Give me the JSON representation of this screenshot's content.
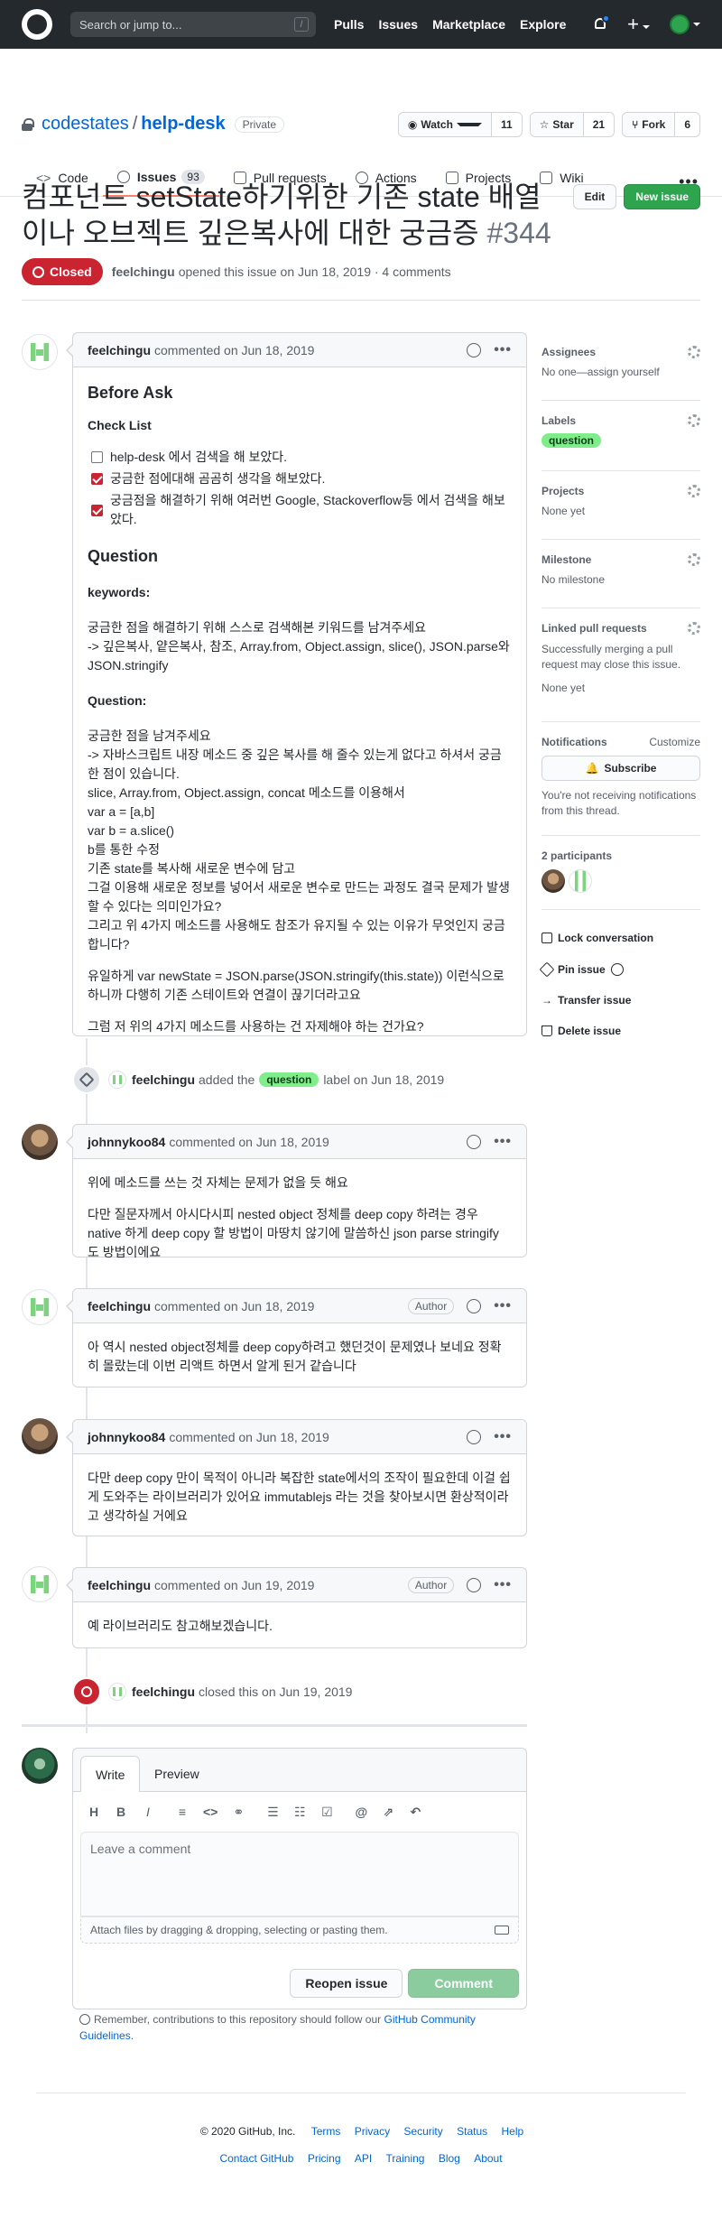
{
  "header": {
    "search_placeholder": "Search or jump to...",
    "search_key": "/",
    "nav": [
      "Pulls",
      "Issues",
      "Marketplace",
      "Explore"
    ]
  },
  "repo": {
    "owner": "codestates",
    "separator": "/",
    "name": "help-desk",
    "visibility": "Private",
    "watch_label": "Watch",
    "watch_count": "11",
    "star_label": "Star",
    "star_count": "21",
    "fork_label": "Fork",
    "fork_count": "6",
    "tabs": [
      {
        "label": "Code",
        "count": ""
      },
      {
        "label": "Issues",
        "count": "93"
      },
      {
        "label": "Pull requests",
        "count": ""
      },
      {
        "label": "Actions",
        "count": ""
      },
      {
        "label": "Projects",
        "count": ""
      },
      {
        "label": "Wiki",
        "count": ""
      }
    ],
    "more": "•••"
  },
  "issue": {
    "title": "컴포넌트 setState하기위한 기존 state 배열이나 오브젝트 깊은복사에 대한 궁금증",
    "number": "#344",
    "edit_label": "Edit",
    "new_issue_label": "New issue",
    "state": "Closed",
    "author": "feelchingu",
    "meta": "opened this issue on Jun 18, 2019 · 4 comments"
  },
  "comments": [
    {
      "author": "feelchingu",
      "date": "commented on Jun 18, 2019",
      "badge": "",
      "before_ask": "Before Ask",
      "checklist_title": "Check List",
      "tasks": [
        {
          "text": "help-desk 에서 검색을 해 보았다.",
          "checked": false
        },
        {
          "text": "궁금한 점에대해 곰곰히 생각을 해보았다.",
          "checked": true
        },
        {
          "text": "궁금점을 해결하기 위해 여러번 Google, Stackoverflow등 에서 검색을 해보았다.",
          "checked": true
        }
      ],
      "question_heading": "Question",
      "keywords_title": "keywords:",
      "keywords_text": "궁금한 점을 해결하기 위해 스스로 검색해본 키워드를 남겨주세요",
      "keywords_list": "-> 깊은복사, 얕은복사, 참조, Array.from, Object.assign, slice(), JSON.parse와 JSON.stringify",
      "question_title": "Question:",
      "question_lines": [
        "궁금한 점을 남겨주세요",
        "-> 자바스크립트 내장 메소드 중 깊은 복사를 해 줄수 있는게 없다고 하셔서 궁금한 점이 있습니다.",
        "slice, Array.from, Object.assign, concat 메소드를 이용해서",
        "var a = [a,b]",
        "var b = a.slice()",
        "b를 통한 수정",
        "기존 state를 복사해 새로운 변수에 담고",
        "그걸 이용해 새로운 정보를 넣어서 새로운 변수로 만드는 과정도 결국 문제가 발생할 수 있다는 의미인가요?",
        "그리고 위 4가지 메소드를 사용해도 참조가 유지될 수 있는 이유가 무엇인지 궁금합니다?"
      ],
      "para2": "유일하게 var newState = JSON.parse(JSON.stringify(this.state)) 이런식으로 하니까 다행히 기존 스테이트와 연결이 끊기더라고요",
      "para3": "그럼 저 위의 4가지 메소드를 사용하는 건 자제해야 하는 건가요?"
    },
    {
      "author": "johnnykoo84",
      "date": "commented on Jun 18, 2019",
      "badge": "",
      "p1": "위에 메소드를 쓰는 것 자체는 문제가 없을 듯 해요",
      "p2": "다만 질문자께서 아시다시피 nested object 정체를 deep copy 하려는 경우 native 하게 deep copy 할 방법이 마땅치 않기에 말씀하신 json parse stringify 도 방법이에요"
    },
    {
      "author": "feelchingu",
      "date": "commented on Jun 18, 2019",
      "badge": "Author",
      "p1": "아 역시 nested object정체를 deep copy하려고 했던것이 문제였나 보네요 정확히 몰랐는데 이번 리액트 하면서 알게 된거 같습니다"
    },
    {
      "author": "johnnykoo84",
      "date": "commented on Jun 18, 2019",
      "badge": "",
      "p1": "다만 deep copy 만이 목적이 아니라 복잡한 state에서의 조작이 필요한데 이걸 쉽게 도와주는 라이브러리가 있어요 immutablejs 라는 것을 찾아보시면 환상적이라고 생각하실 거에요"
    },
    {
      "author": "feelchingu",
      "date": "commented on Jun 19, 2019",
      "badge": "Author",
      "p1": "예 라이브러리도 참고해보겠습니다."
    }
  ],
  "events": {
    "label_event": {
      "actor": "feelchingu",
      "pre": "added the",
      "label": "question",
      "post": "label on Jun 18, 2019"
    },
    "close_event": {
      "actor": "feelchingu",
      "text": "closed this on Jun 19, 2019"
    }
  },
  "sidebar": {
    "assignees_title": "Assignees",
    "assignees_value": "No one—assign yourself",
    "labels_title": "Labels",
    "label": "question",
    "projects_title": "Projects",
    "projects_value": "None yet",
    "milestone_title": "Milestone",
    "milestone_value": "No milestone",
    "linked_title": "Linked pull requests",
    "linked_desc": "Successfully merging a pull request may close this issue.",
    "linked_value": "None yet",
    "notifications_title": "Notifications",
    "customize": "Customize",
    "subscribe": "Subscribe",
    "notif_desc": "You're not receiving notifications from this thread.",
    "participants_title": "2 participants",
    "lock": "Lock conversation",
    "pin": "Pin issue",
    "transfer": "Transfer issue",
    "delete": "Delete issue"
  },
  "editor": {
    "tab_write": "Write",
    "tab_preview": "Preview",
    "placeholder": "Leave a comment",
    "attach": "Attach files by dragging & dropping, selecting or pasting them.",
    "reopen": "Reopen issue",
    "comment": "Comment"
  },
  "remember": {
    "text": "Remember, contributions to this repository should follow our",
    "link": "GitHub Community Guidelines",
    "end": "."
  },
  "footer": {
    "copyright": "© 2020 GitHub, Inc.",
    "row1": [
      "Terms",
      "Privacy",
      "Security",
      "Status",
      "Help"
    ],
    "row2": [
      "Contact GitHub",
      "Pricing",
      "API",
      "Training",
      "Blog",
      "About"
    ]
  }
}
